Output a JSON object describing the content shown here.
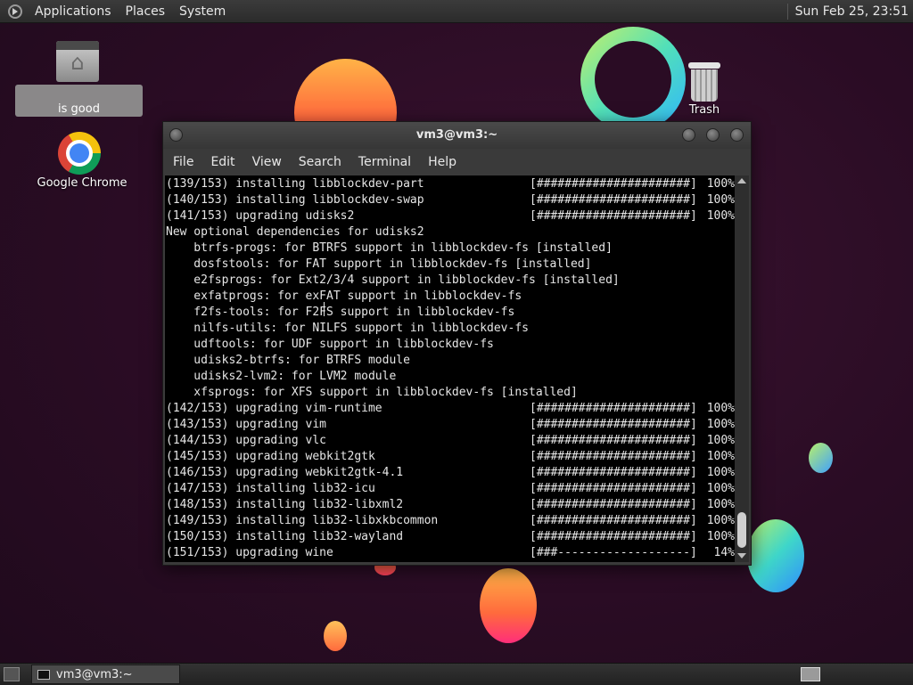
{
  "top_panel": {
    "menus": [
      "Applications",
      "Places",
      "System"
    ],
    "clock": "Sun Feb 25, 23:51"
  },
  "desktop": {
    "icons": [
      {
        "label": "is good",
        "icon": "home-folder-icon"
      },
      {
        "label": "Google Chrome",
        "icon": "chrome-icon"
      },
      {
        "label": "Trash",
        "icon": "trash-icon"
      }
    ]
  },
  "window": {
    "title": "vm3@vm3:~",
    "menu": [
      "File",
      "Edit",
      "View",
      "Search",
      "Terminal",
      "Help"
    ]
  },
  "terminal": {
    "lines": [
      {
        "text": "(139/153) installing libblockdev-part",
        "bar": "[######################]",
        "pct": "100%"
      },
      {
        "text": "(140/153) installing libblockdev-swap",
        "bar": "[######################]",
        "pct": "100%"
      },
      {
        "text": "(141/153) upgrading udisks2",
        "bar": "[######################]",
        "pct": "100%"
      },
      {
        "text": "New optional dependencies for udisks2",
        "bar": "",
        "pct": ""
      },
      {
        "text": "    btrfs-progs: for BTRFS support in libblockdev-fs [installed]",
        "bar": "",
        "pct": ""
      },
      {
        "text": "    dosfstools: for FAT support in libblockdev-fs [installed]",
        "bar": "",
        "pct": ""
      },
      {
        "text": "    e2fsprogs: for Ext2/3/4 support in libblockdev-fs [installed]",
        "bar": "",
        "pct": ""
      },
      {
        "text": "    exfatprogs: for exFAT support in libblockdev-fs",
        "bar": "",
        "pct": ""
      },
      {
        "text": "    f2fs-tools: for F2FS support in libblockdev-fs",
        "bar": "",
        "pct": ""
      },
      {
        "text": "    nilfs-utils: for NILFS support in libblockdev-fs",
        "bar": "",
        "pct": ""
      },
      {
        "text": "    udftools: for UDF support in libblockdev-fs",
        "bar": "",
        "pct": ""
      },
      {
        "text": "    udisks2-btrfs: for BTRFS module",
        "bar": "",
        "pct": ""
      },
      {
        "text": "    udisks2-lvm2: for LVM2 module",
        "bar": "",
        "pct": ""
      },
      {
        "text": "    xfsprogs: for XFS support in libblockdev-fs [installed]",
        "bar": "",
        "pct": ""
      },
      {
        "text": "(142/153) upgrading vim-runtime",
        "bar": "[######################]",
        "pct": "100%"
      },
      {
        "text": "(143/153) upgrading vim",
        "bar": "[######################]",
        "pct": "100%"
      },
      {
        "text": "(144/153) upgrading vlc",
        "bar": "[######################]",
        "pct": "100%"
      },
      {
        "text": "(145/153) upgrading webkit2gtk",
        "bar": "[######################]",
        "pct": "100%"
      },
      {
        "text": "(146/153) upgrading webkit2gtk-4.1",
        "bar": "[######################]",
        "pct": "100%"
      },
      {
        "text": "(147/153) installing lib32-icu",
        "bar": "[######################]",
        "pct": "100%"
      },
      {
        "text": "(148/153) installing lib32-libxml2",
        "bar": "[######################]",
        "pct": "100%"
      },
      {
        "text": "(149/153) installing lib32-libxkbcommon",
        "bar": "[######################]",
        "pct": "100%"
      },
      {
        "text": "(150/153) installing lib32-wayland",
        "bar": "[######################]",
        "pct": "100%"
      },
      {
        "text": "(151/153) upgrading wine",
        "bar": "[###-------------------]",
        "pct": "14%"
      }
    ]
  },
  "taskbar": {
    "task_label": "vm3@vm3:~"
  }
}
